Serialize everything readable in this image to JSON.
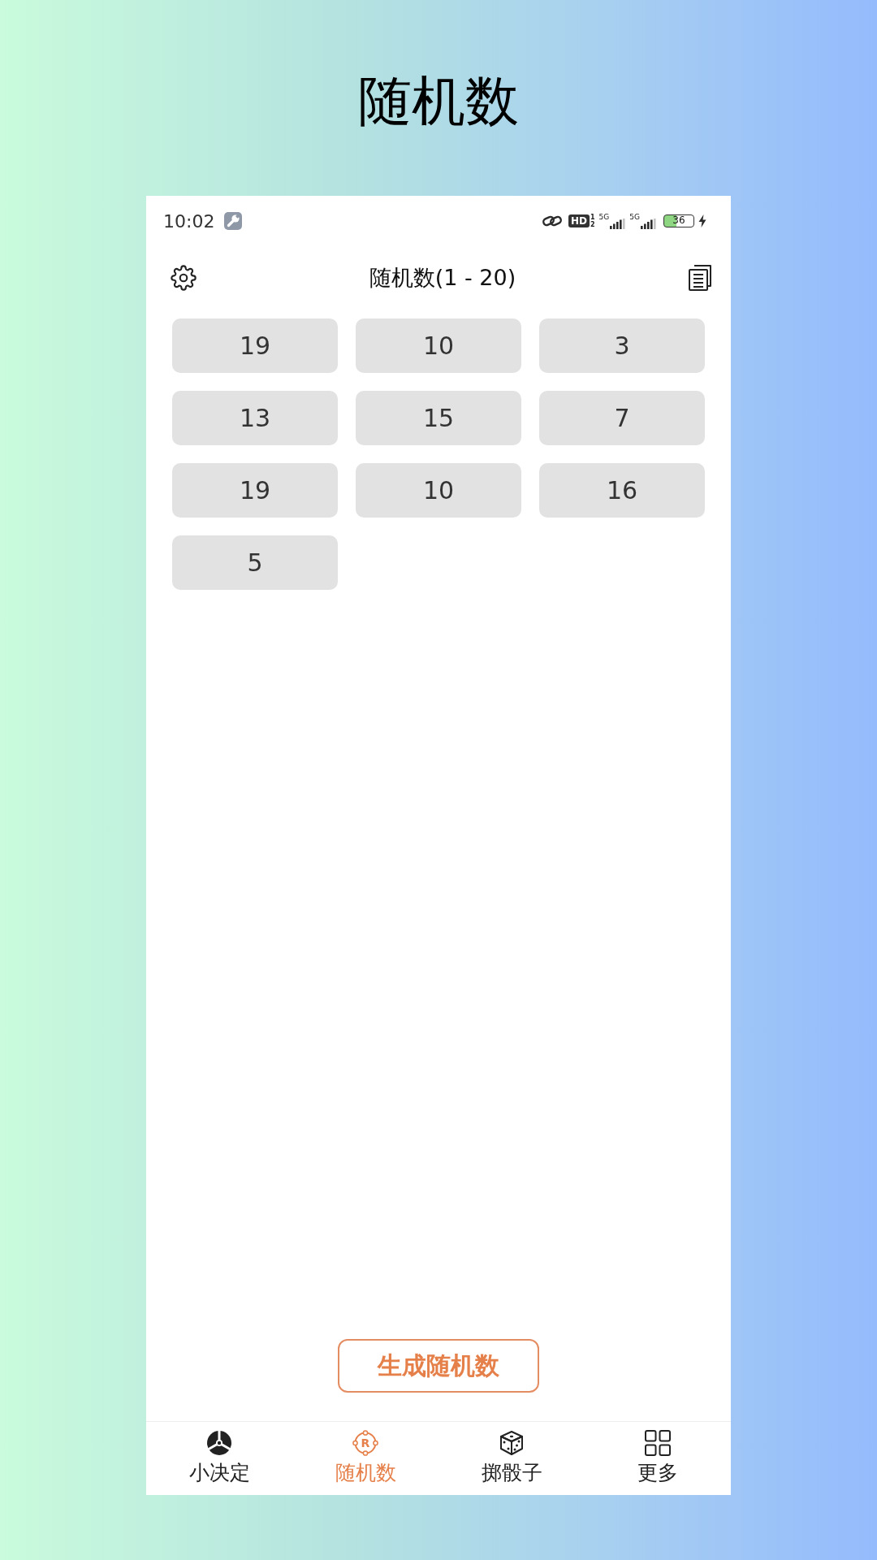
{
  "page_title": "随机数",
  "status_bar": {
    "time": "10:02",
    "hd_label": "HD",
    "hd_digits": [
      "1",
      "2"
    ],
    "networks": [
      "5G",
      "5G"
    ],
    "battery": "36"
  },
  "header": {
    "title": "随机数(1 - 20)"
  },
  "results": [
    "19",
    "10",
    "3",
    "13",
    "15",
    "7",
    "19",
    "10",
    "16",
    "5"
  ],
  "generate_button": "生成随机数",
  "tabs": [
    {
      "kind": "decide",
      "label": "小决定",
      "selected": false
    },
    {
      "kind": "random",
      "label": "随机数",
      "icon_letter": "R",
      "selected": true
    },
    {
      "kind": "dice",
      "label": "掷骰子",
      "selected": false
    },
    {
      "kind": "more",
      "label": "更多",
      "selected": false
    }
  ]
}
